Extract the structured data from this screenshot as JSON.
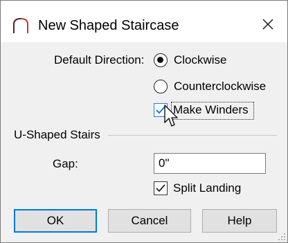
{
  "window": {
    "title": "New Shaped Staircase",
    "title_icon": "arch-icon",
    "close_label": "×"
  },
  "direction": {
    "label": "Default Direction:",
    "options": [
      {
        "label": "Clockwise",
        "checked": true
      },
      {
        "label": "Counterclockwise",
        "checked": false
      }
    ]
  },
  "winders": {
    "label": "Make Winders",
    "checked": true,
    "focused": true
  },
  "u_shaped": {
    "group_label": "U-Shaped Stairs",
    "gap_label": "Gap:",
    "gap_value": "0\"",
    "split_landing_label": "Split Landing",
    "split_landing_checked": true
  },
  "buttons": {
    "ok": "OK",
    "cancel": "Cancel",
    "help": "Help"
  },
  "colors": {
    "accent": "#0078d7",
    "hover_check": "#1e7be0",
    "dialog_bg": "#f0f0f0"
  }
}
